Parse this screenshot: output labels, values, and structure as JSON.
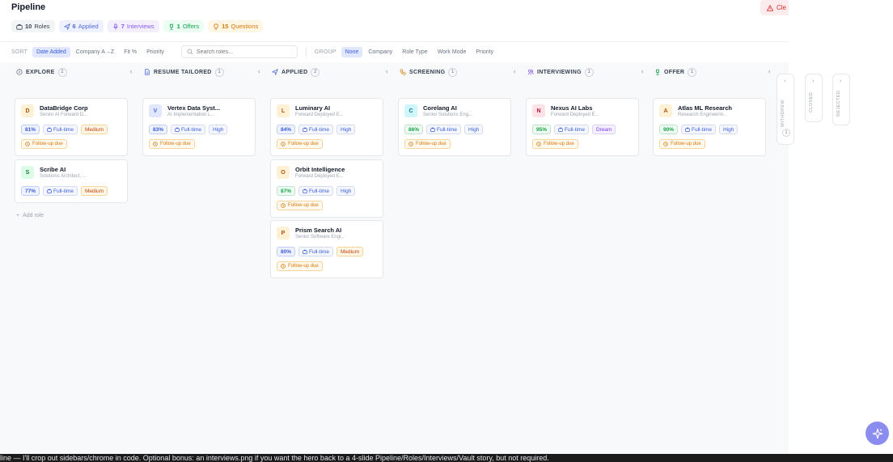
{
  "header": {
    "title": "Pipeline",
    "clear_label": "Cle"
  },
  "stats": {
    "roles": {
      "count": "10",
      "label": "Roles"
    },
    "applied": {
      "count": "6",
      "label": "Applied"
    },
    "interviews": {
      "count": "7",
      "label": "Interviews"
    },
    "offers": {
      "count": "1",
      "label": "Offers"
    },
    "questions": {
      "count": "15",
      "label": "Questions"
    }
  },
  "toolbar": {
    "sort_label": "SORT",
    "sort_options": [
      "Date Added",
      "Company A→Z",
      "Fit %",
      "Priority"
    ],
    "search_placeholder": "Search roles...",
    "group_label": "GROUP",
    "group_options": [
      "None",
      "Company",
      "Role Type",
      "Work Mode",
      "Priority"
    ]
  },
  "columns": [
    {
      "title": "EXPLORE",
      "count": "2"
    },
    {
      "title": "RESUME TAILORED",
      "count": "1"
    },
    {
      "title": "APPLIED",
      "count": "2"
    },
    {
      "title": "SCREENING",
      "count": "1"
    },
    {
      "title": "INTERVIEWING",
      "count": "1"
    },
    {
      "title": "OFFER",
      "count": "1"
    }
  ],
  "cards": {
    "databridge": {
      "initial": "D",
      "company": "DataBridge Corp",
      "role": "Senior AI Forward D...",
      "fit": "81%",
      "type": "Full-time",
      "priority": "Medium",
      "followup": "Follow-up due"
    },
    "scribe": {
      "initial": "S",
      "company": "Scribe AI",
      "role": "Solutions Architect, ...",
      "fit": "77%",
      "type": "Full-time",
      "priority": "Medium"
    },
    "vertex": {
      "initial": "V",
      "company": "Vertex Data Syst...",
      "role": "AI Implementation L...",
      "fit": "83%",
      "type": "Full-time",
      "priority": "High",
      "followup": "Follow-up due"
    },
    "luminary": {
      "initial": "L",
      "company": "Luminary AI",
      "role": "Forward Deployed E...",
      "fit": "84%",
      "type": "Full-time",
      "priority": "High",
      "followup": "Follow-up due"
    },
    "orbit": {
      "initial": "O",
      "company": "Orbit Intelligence",
      "role": "Forward Deployed E...",
      "fit": "87%",
      "type": "Full-time",
      "priority": "High",
      "followup": "Follow-up due"
    },
    "prism": {
      "initial": "P",
      "company": "Prism Search AI",
      "role": "Senior Software Engi...",
      "fit": "80%",
      "type": "Full-time",
      "priority": "Medium",
      "followup": "Follow-up due"
    },
    "corelang": {
      "initial": "C",
      "company": "Corelang AI",
      "role": "Senior Solutions Eng...",
      "fit": "86%",
      "type": "Full-time",
      "priority": "High",
      "followup": "Follow-up due"
    },
    "nexus": {
      "initial": "N",
      "company": "Nexus AI Labs",
      "role": "Forward Deployed E...",
      "fit": "95%",
      "type": "Full-time",
      "priority": "Dream",
      "followup": "Follow-up due"
    },
    "atlas": {
      "initial": "A",
      "company": "Atlas ML Research",
      "role": "Research Engineerin...",
      "fit": "90%",
      "type": "Full-time",
      "priority": "High",
      "followup": "Follow-up due"
    }
  },
  "add_role_label": "Add role",
  "side_columns": [
    {
      "title": "WITHDREW",
      "count": "1"
    },
    {
      "title": "CLOSED"
    },
    {
      "title": "REJECTED"
    }
  ],
  "bottom_text": "line — I'll crop out sidebars/chrome in code. Optional bonus: an interviews.png if you want the hero back to a 4-slide Pipeline/Roles/Interviews/Vault story, but not required.",
  "colors": {
    "accent": "#3b5bdb",
    "fab": "#8b8cf0"
  }
}
